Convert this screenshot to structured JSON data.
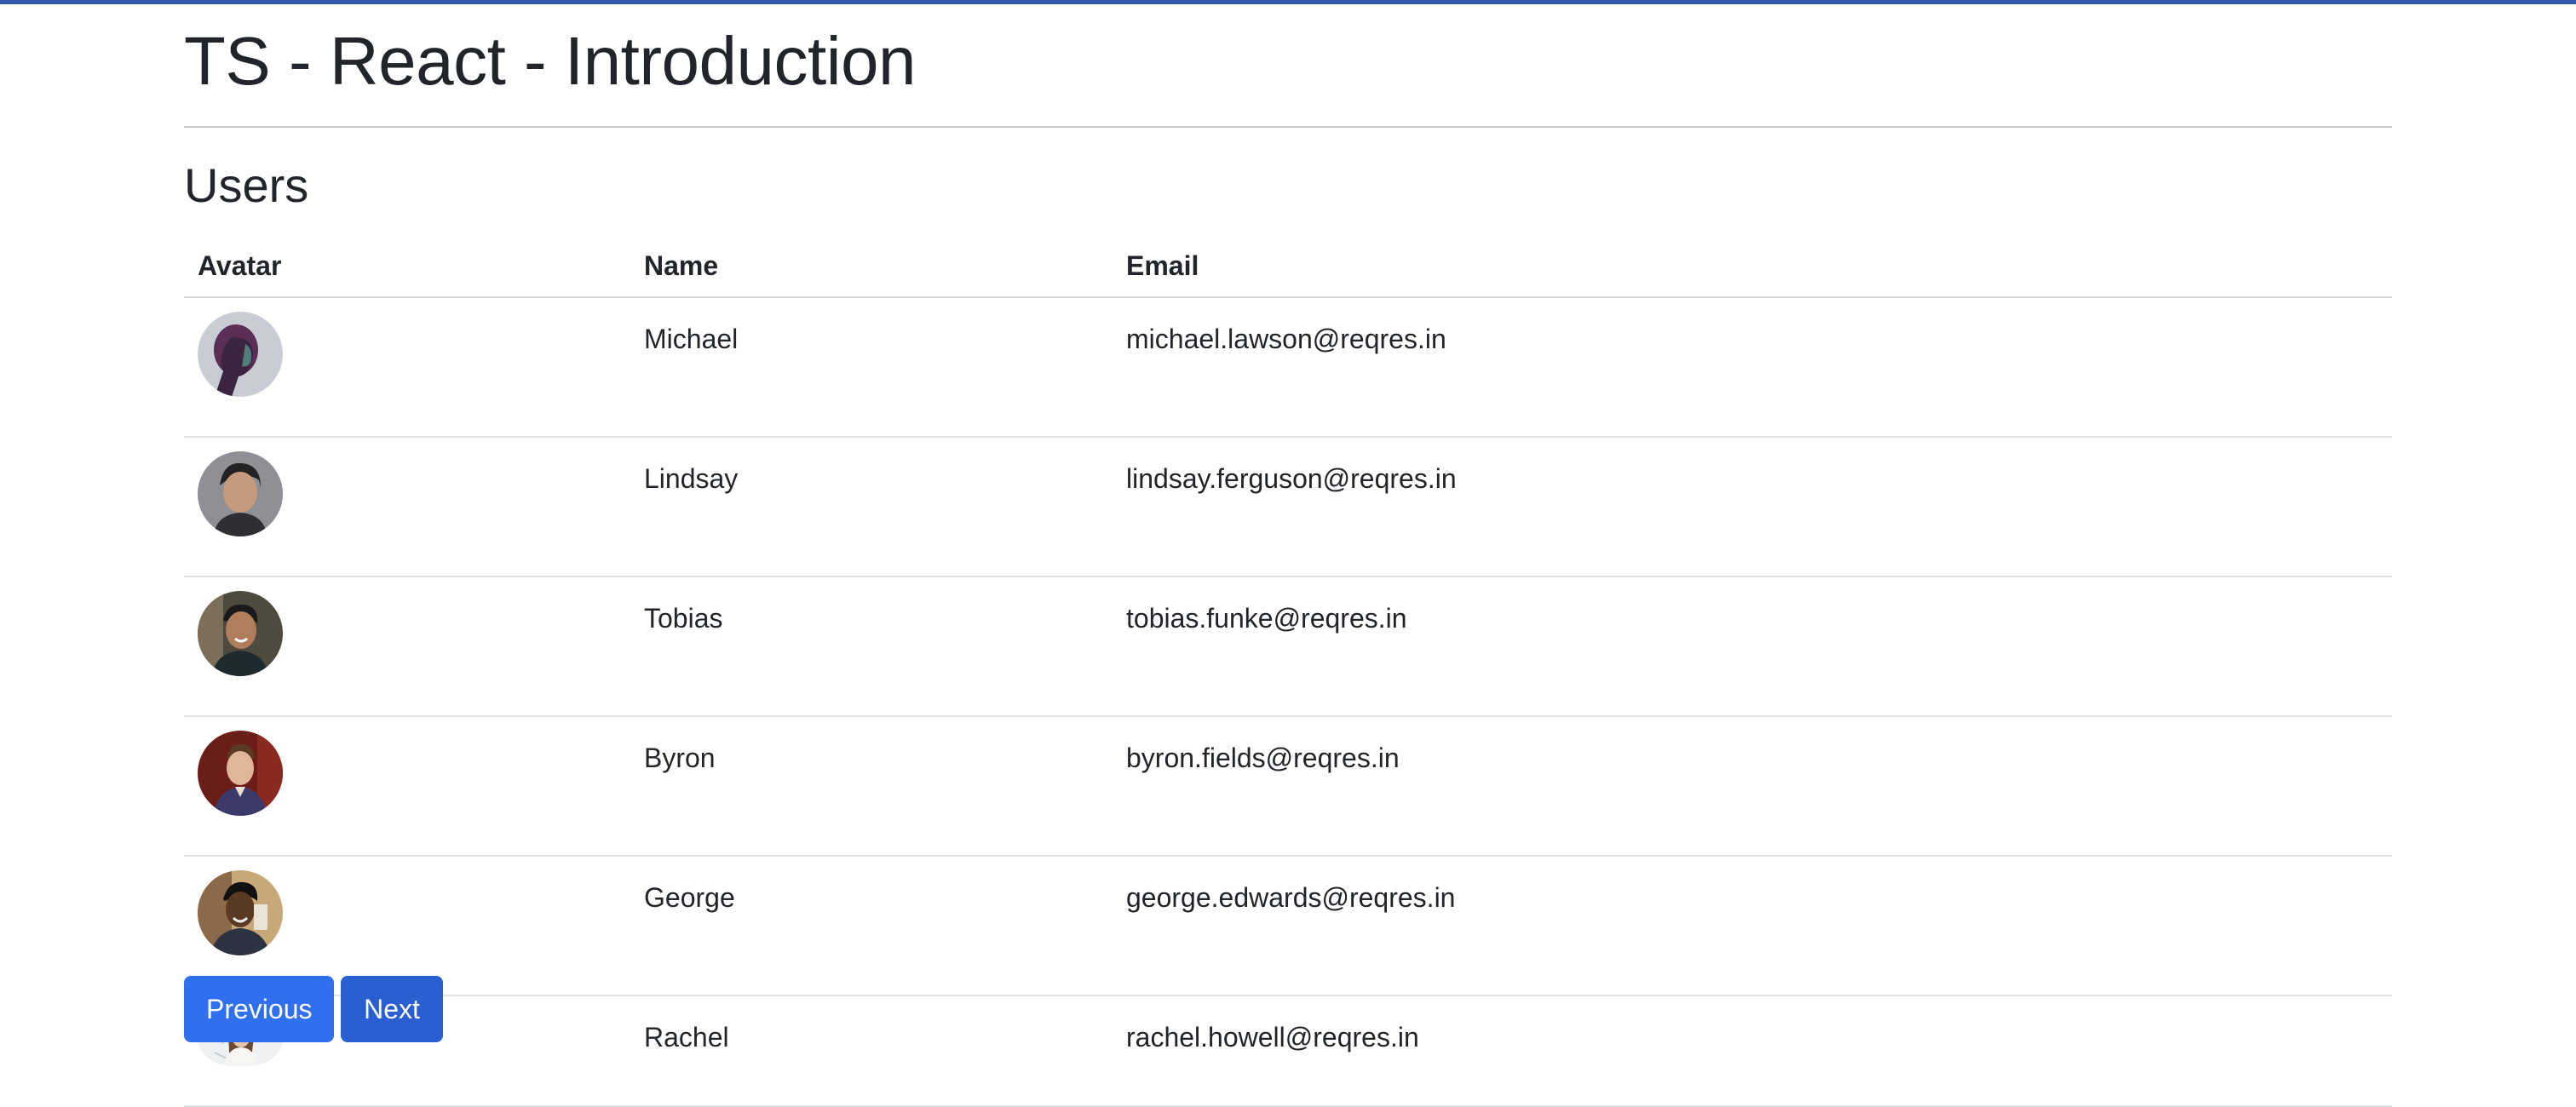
{
  "page": {
    "title": "TS - React - Introduction",
    "section_title": "Users",
    "accent_color": "#2f5aa8"
  },
  "table": {
    "headers": [
      "Avatar",
      "Name",
      "Email"
    ],
    "rows": [
      {
        "name": "Michael",
        "email": "michael.lawson@reqres.in",
        "avatar": "michael-avatar"
      },
      {
        "name": "Lindsay",
        "email": "lindsay.ferguson@reqres.in",
        "avatar": "lindsay-avatar"
      },
      {
        "name": "Tobias",
        "email": "tobias.funke@reqres.in",
        "avatar": "tobias-avatar"
      },
      {
        "name": "Byron",
        "email": "byron.fields@reqres.in",
        "avatar": "byron-avatar"
      },
      {
        "name": "George",
        "email": "george.edwards@reqres.in",
        "avatar": "george-avatar"
      },
      {
        "name": "Rachel",
        "email": "rachel.howell@reqres.in",
        "avatar": "rachel-avatar"
      }
    ]
  },
  "pagination": {
    "previous_label": "Previous",
    "next_label": "Next",
    "button_color": "#2f6ff0"
  }
}
